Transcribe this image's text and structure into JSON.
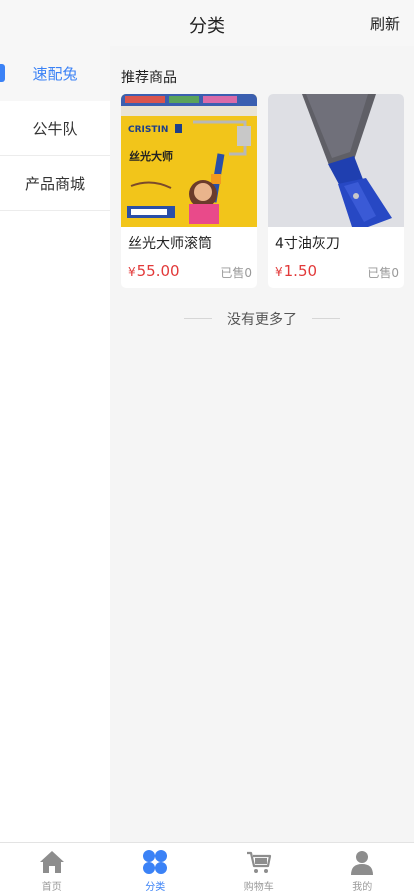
{
  "header": {
    "title": "分类",
    "refresh_label": "刷新"
  },
  "sidebar": {
    "items": [
      {
        "label": "速配兔",
        "active": true
      },
      {
        "label": "公牛队",
        "active": false
      },
      {
        "label": "产品商城",
        "active": false
      }
    ]
  },
  "main": {
    "section_title": "推荐商品",
    "products": [
      {
        "name": "丝光大师滚筒",
        "currency": "¥",
        "price": "55.00",
        "sold": "已售0",
        "image_brand": "CRISTIN",
        "image_tagline": "丝光大师"
      },
      {
        "name": "4寸油灰刀",
        "currency": "¥",
        "price": "1.50",
        "sold": "已售0"
      }
    ],
    "end_text": "没有更多了"
  },
  "tabbar": {
    "items": [
      {
        "label": "首页",
        "icon": "home-icon",
        "active": false
      },
      {
        "label": "分类",
        "icon": "category-icon",
        "active": true
      },
      {
        "label": "购物车",
        "icon": "cart-icon",
        "active": false
      },
      {
        "label": "我的",
        "icon": "user-icon",
        "active": false
      }
    ]
  },
  "colors": {
    "accent": "#3b82f6",
    "price": "#e23a3a"
  }
}
